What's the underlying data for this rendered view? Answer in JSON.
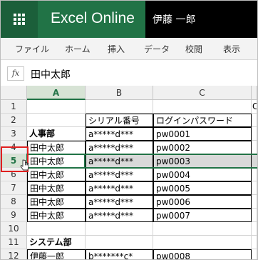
{
  "app": {
    "title": "Excel Online",
    "user": "伊藤 一郎"
  },
  "ribbon": {
    "tabs": [
      "ファイル",
      "ホーム",
      "挿入",
      "データ",
      "校閲",
      "表示"
    ]
  },
  "formula_bar": {
    "icon": "fx",
    "value": "田中太郎"
  },
  "columns": [
    "A",
    "B",
    "C"
  ],
  "rows": [
    {
      "num": "1",
      "cells": [
        "",
        "",
        "",
        "C"
      ]
    },
    {
      "num": "2",
      "cells": [
        "",
        "シリアル番号",
        "ログインパスワード",
        ""
      ]
    },
    {
      "num": "3",
      "cells": [
        "人事部",
        "a*****d***",
        "pw0001",
        ""
      ]
    },
    {
      "num": "4",
      "cells": [
        "田中太郎",
        "a*****d***",
        "pw0002",
        ""
      ]
    },
    {
      "num": "5",
      "cells": [
        "田中太郎",
        "a*****d***",
        "pw0003",
        ""
      ]
    },
    {
      "num": "6",
      "cells": [
        "田中太郎",
        "a*****d***",
        "pw0004",
        ""
      ]
    },
    {
      "num": "7",
      "cells": [
        "田中太郎",
        "a*****d***",
        "pw0005",
        ""
      ]
    },
    {
      "num": "8",
      "cells": [
        "田中太郎",
        "a*****d***",
        "pw0006",
        ""
      ]
    },
    {
      "num": "9",
      "cells": [
        "田中太郎",
        "a*****d***",
        "pw0007",
        ""
      ]
    },
    {
      "num": "10",
      "cells": [
        "",
        "",
        "",
        ""
      ]
    },
    {
      "num": "11",
      "cells": [
        "システム部",
        "",
        "",
        ""
      ]
    },
    {
      "num": "12",
      "cells": [
        "伊藤一郎",
        "b*******c*",
        "pw0008",
        ""
      ]
    }
  ],
  "selection": {
    "row": "5",
    "column": "A"
  },
  "colors": {
    "brand": "#217346",
    "highlight": "#d9d9d9",
    "annotation": "#e02020"
  },
  "icons": {
    "app_launcher": "waffle-grid-icon",
    "function": "fx-icon",
    "pointer": "hand-cursor-icon"
  }
}
